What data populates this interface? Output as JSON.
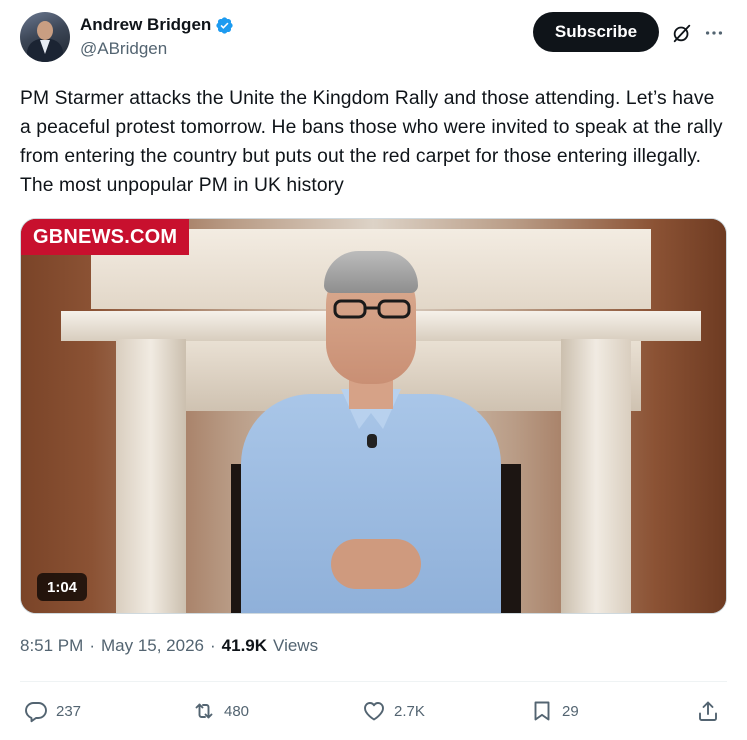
{
  "author": {
    "display_name": "Andrew Bridgen",
    "handle": "@ABridgen",
    "verified": true
  },
  "header": {
    "subscribe_label": "Subscribe",
    "grok_icon": "grok-icon",
    "more_icon": "more-icon"
  },
  "tweet": {
    "text": "PM Starmer attacks the Unite the Kingdom Rally and those attending. Let’s have a peaceful protest tomorrow. He bans those who were invited to speak at the rally from entering the country but puts out the red carpet for those entering illegally. The most unpopular PM in UK history"
  },
  "media": {
    "watermark": "GBNEWS.COM",
    "duration": "1:04",
    "watermark_color": "#c8102e"
  },
  "meta": {
    "time": "8:51 PM",
    "separator": "·",
    "date": "May 15, 2026",
    "views_count": "41.9K",
    "views_label": "Views"
  },
  "actions": {
    "replies": "237",
    "reposts": "480",
    "likes": "2.7K",
    "bookmarks": "29"
  },
  "colors": {
    "text_primary": "#0f1419",
    "text_secondary": "#536471",
    "verified_blue": "#1d9bf0"
  }
}
